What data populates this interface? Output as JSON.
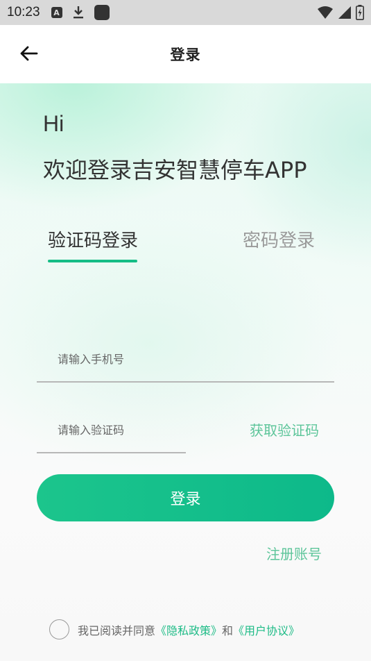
{
  "status_bar": {
    "time": "10:23",
    "icons": [
      "a-notification-icon",
      "download-icon",
      "square-app-icon",
      "wifi-icon",
      "signal-icon",
      "battery-icon"
    ]
  },
  "header": {
    "title": "登录",
    "back_icon": "arrow-left-icon"
  },
  "greeting": {
    "hi": "Hi",
    "welcome": "欢迎登录吉安智慧停车APP"
  },
  "tabs": [
    {
      "label": "验证码登录",
      "active": true
    },
    {
      "label": "密码登录",
      "active": false
    }
  ],
  "form": {
    "phone_placeholder": "请输入手机号",
    "phone_value": "",
    "code_placeholder": "请输入验证码",
    "code_value": "",
    "get_code_label": "获取验证码",
    "login_label": "登录",
    "register_label": "注册账号"
  },
  "agreement": {
    "checked": false,
    "prefix": "我已阅读并同意",
    "privacy_link": "《隐私政策》",
    "and": "和",
    "user_link": "《用户协议》"
  },
  "colors": {
    "accent": "#15bd86",
    "link": "#5dc59a",
    "status_bar": "#d9d9d9"
  }
}
